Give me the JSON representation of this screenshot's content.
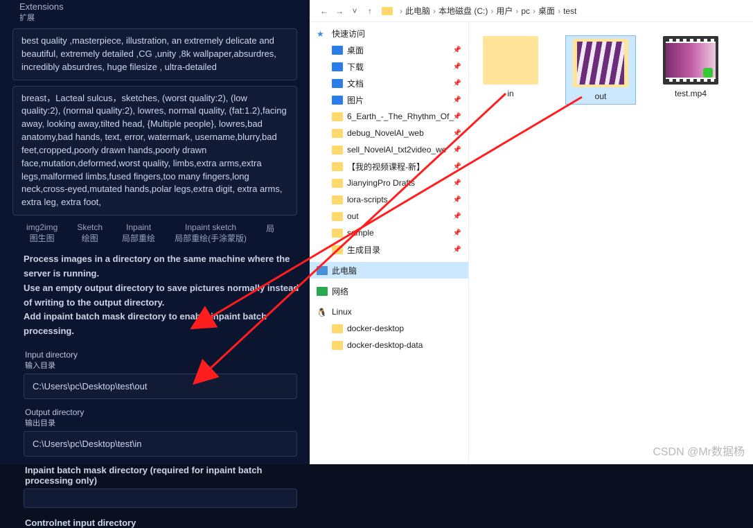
{
  "left": {
    "extensions_label_en": "Extensions",
    "extensions_label_cn": "扩展",
    "prompt_text": "best quality ,masterpiece, illustration, an extremely delicate and beautiful, extremely detailed ,CG ,unity ,8k wallpaper,absurdres, incredibly absurdres, huge filesize , ultra-detailed",
    "neg_prompt_text": "breast，Lacteal sulcus，sketches, (worst quality:2), (low quality:2), (normal quality:2), lowres, normal quality, (fat:1.2),facing away, looking away,tilted head, {Multiple people}, lowres,bad anatomy,bad hands, text, error, watermark, username,blurry,bad feet,cropped,poorly drawn hands,poorly drawn face,mutation,deformed,worst quality, limbs,extra arms,extra legs,malformed limbs,fused fingers,too many fingers,long neck,cross-eyed,mutated hands,polar legs,extra digit, extra arms, extra leg, extra foot,",
    "tabs": [
      {
        "en": "img2img",
        "cn": "图生图"
      },
      {
        "en": "Sketch",
        "cn": "绘图"
      },
      {
        "en": "Inpaint",
        "cn": "局部重绘"
      },
      {
        "en": "Inpaint sketch",
        "cn": "局部重绘(手涂蒙版)"
      },
      {
        "en": "局",
        "cn": ""
      }
    ],
    "help_line1": "Process images in a directory on the same machine where the server is running.",
    "help_line2": "Use an empty output directory to save pictures normally instead of writing to the output directory.",
    "help_line3": "Add inpaint batch mask directory to enable inpaint batch processing.",
    "input_label_en": "Input directory",
    "input_label_cn": "输入目录",
    "input_value": "C:\\Users\\pc\\Desktop\\test\\out",
    "output_label_en": "Output directory",
    "output_label_cn": "输出目录",
    "output_value": "C:\\Users\\pc\\Desktop\\test\\in",
    "mask_label": "Inpaint batch mask directory (required for inpaint batch processing only)",
    "controlnet_label": "Controlnet input directory"
  },
  "explorer": {
    "breadcrumb": [
      "此电脑",
      "本地磁盘 (C:)",
      "用户",
      "pc",
      "桌面",
      "test"
    ],
    "tree": {
      "quick": "快速访问",
      "desktop": "桌面",
      "downloads": "下载",
      "documents": "文档",
      "pictures": "图片",
      "f1": "6_Earth_-_The_Rhythm_Of_",
      "f2": "debug_NovelAI_web",
      "f3": "sell_NovelAI_txt2video_we",
      "f4": "【我的视频课程-新】",
      "f5": "JianyingPro Drafts",
      "f6": "lora-scripts",
      "f7": "out",
      "f8": "sample",
      "f9": "生成目录",
      "pc": "此电脑",
      "net": "网络",
      "linux": "Linux",
      "d1": "docker-desktop",
      "d2": "docker-desktop-data"
    },
    "files": {
      "in": "in",
      "out": "out",
      "video": "test.mp4"
    }
  },
  "watermark": "CSDN @Mr数据杨"
}
